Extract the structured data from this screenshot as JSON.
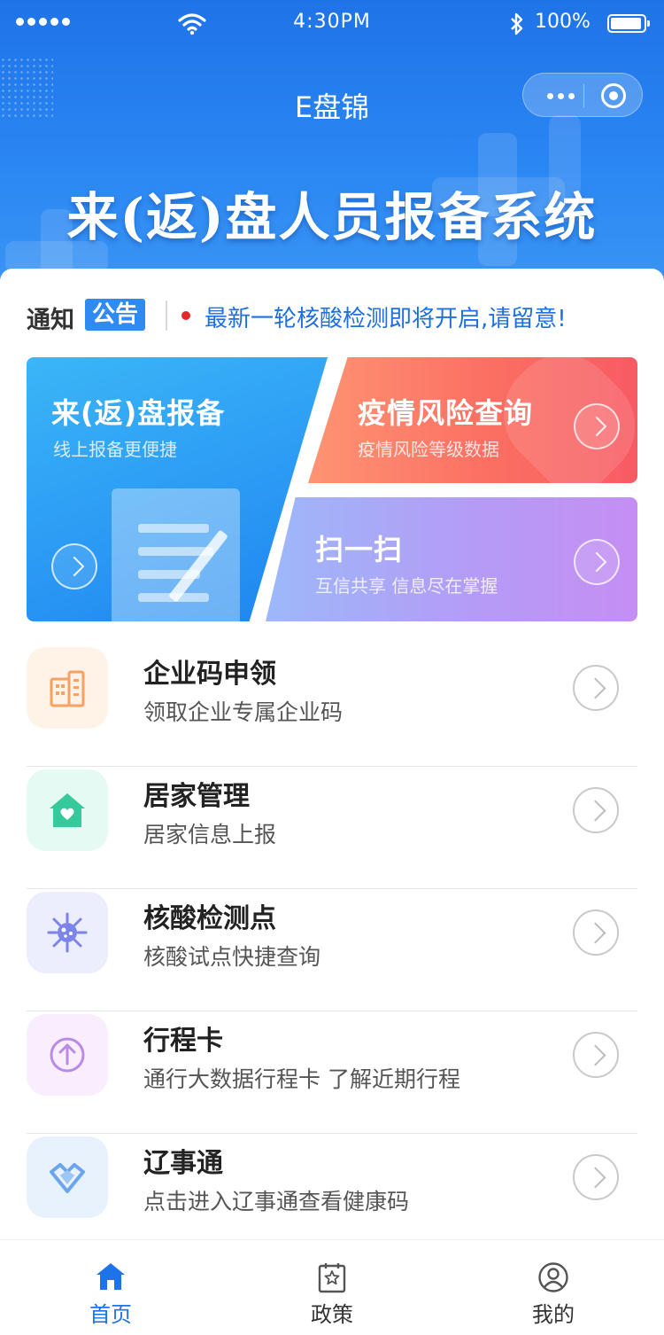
{
  "status_bar": {
    "time": "4:30PM",
    "battery": "100%"
  },
  "header": {
    "app_title": "E盘锦",
    "system_title": "来(返)盘人员报备系统"
  },
  "notice": {
    "label_part1": "通知",
    "label_part2": "公告",
    "text": "最新一轮核酸检测即将开启,请留意!"
  },
  "feature_cards": [
    {
      "title": "来(返)盘报备",
      "subtitle": "线上报备更便捷"
    },
    {
      "title": "疫情风险查询",
      "subtitle": "疫情风险等级数据"
    },
    {
      "title": "扫一扫",
      "subtitle": "互信共享 信息尽在掌握"
    }
  ],
  "services": [
    {
      "title": "企业码申领",
      "subtitle": "领取企业专属企业码",
      "icon": "building-icon",
      "color": "#f7a262"
    },
    {
      "title": "居家管理",
      "subtitle": "居家信息上报",
      "icon": "home-heart-icon",
      "color": "#35c99b"
    },
    {
      "title": "核酸检测点",
      "subtitle": "核酸试点快捷查询",
      "icon": "virus-icon",
      "color": "#7b84e8"
    },
    {
      "title": "行程卡",
      "subtitle": "通行大数据行程卡 了解近期行程",
      "icon": "up-arrow-circle-icon",
      "color": "#b98be6"
    },
    {
      "title": "辽事通",
      "subtitle": "点击进入辽事通查看健康码",
      "icon": "liao-logo-icon",
      "color": "#6aa5ee"
    }
  ],
  "tabbar": {
    "tabs": [
      {
        "label": "首页",
        "icon": "home-icon",
        "active": true
      },
      {
        "label": "政策",
        "icon": "policy-icon",
        "active": false
      },
      {
        "label": "我的",
        "icon": "user-icon",
        "active": false
      }
    ]
  },
  "colors": {
    "brand_blue": "#1f73e8",
    "notice_text": "#1f6fe0",
    "notice_dot": "#e12b2b"
  }
}
